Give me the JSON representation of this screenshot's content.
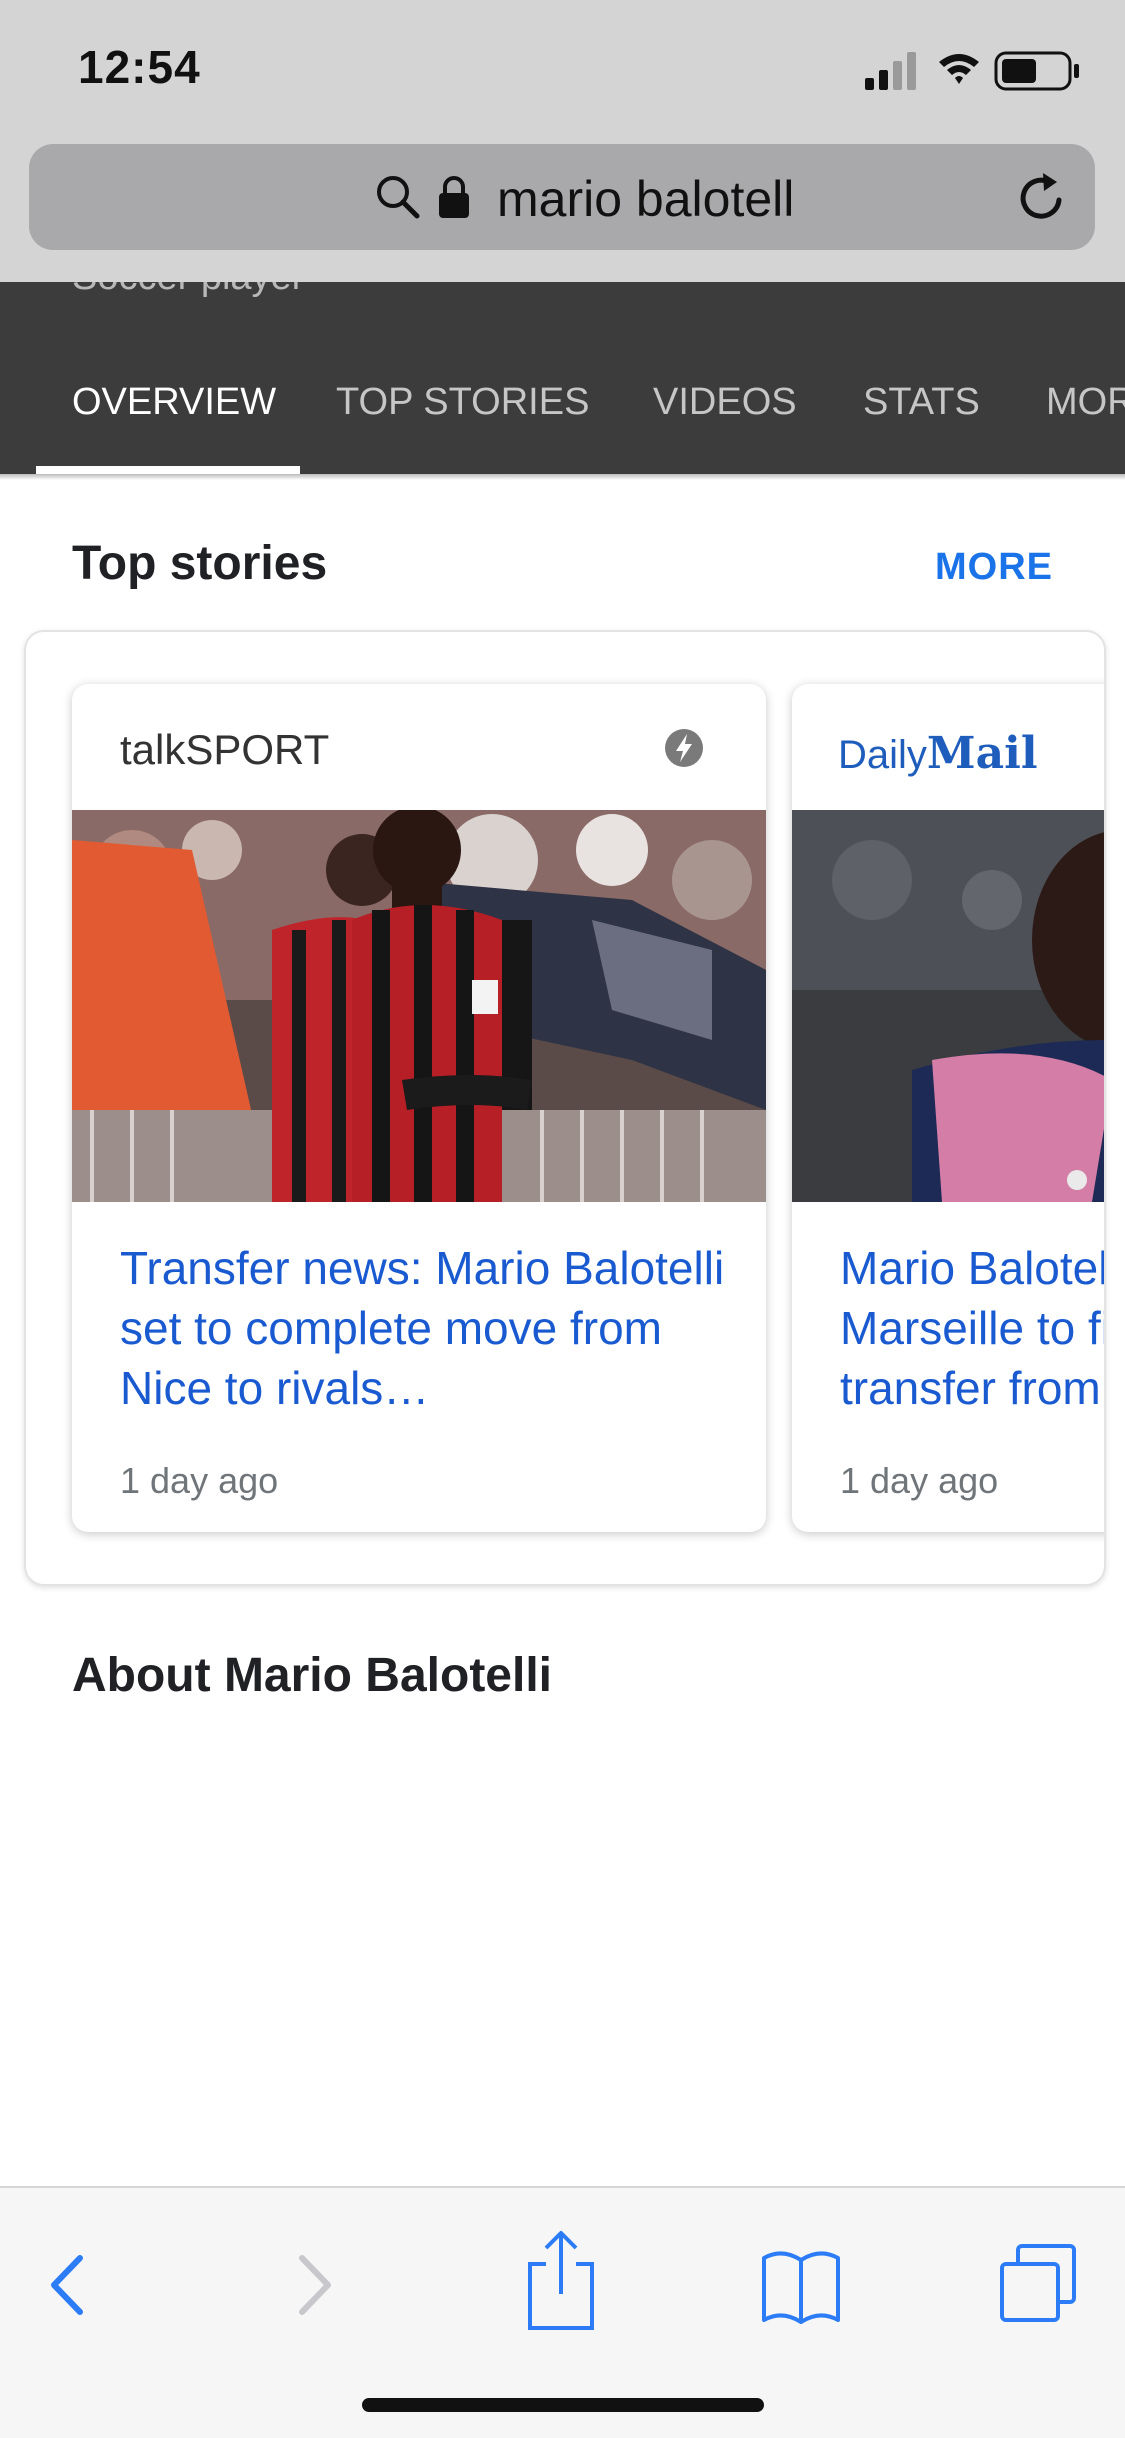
{
  "status_bar": {
    "time": "12:54",
    "icons": [
      "cellular-signal-icon",
      "wifi-icon",
      "battery-icon"
    ]
  },
  "url_bar": {
    "query": "mario balotell",
    "icons": [
      "search-icon",
      "lock-icon",
      "reload-icon"
    ]
  },
  "entity": {
    "subtitle": "Soccer player"
  },
  "tabs": [
    {
      "label": "OVERVIEW",
      "active": true
    },
    {
      "label": "TOP STORIES",
      "active": false
    },
    {
      "label": "VIDEOS",
      "active": false
    },
    {
      "label": "STATS",
      "active": false
    },
    {
      "label": "MORE",
      "active": false
    }
  ],
  "top_stories": {
    "title": "Top stories",
    "more_label": "MORE",
    "stories": [
      {
        "source": "talkSPORT",
        "headline": "Transfer news: Mario Balotelli set to complete move from Nice to rivals…",
        "time": "1 day ago",
        "amp": true
      },
      {
        "source_logo_1": "Daily",
        "source_logo_2": "Mail",
        "headline": "Mario Balotelli set to join Marseille to finalise his transfer from",
        "time": "1 day ago"
      }
    ]
  },
  "about": {
    "title": "About Mario Balotelli"
  },
  "toolbar": {
    "icons": [
      "back-icon",
      "forward-icon",
      "share-icon",
      "bookmarks-icon",
      "tabs-icon"
    ]
  },
  "colors": {
    "link_blue": "#1a5ad1",
    "accent_blue": "#1a73e8",
    "tab_bar_bg": "#3c3c3c",
    "ios_tint": "#2b7cf6"
  }
}
